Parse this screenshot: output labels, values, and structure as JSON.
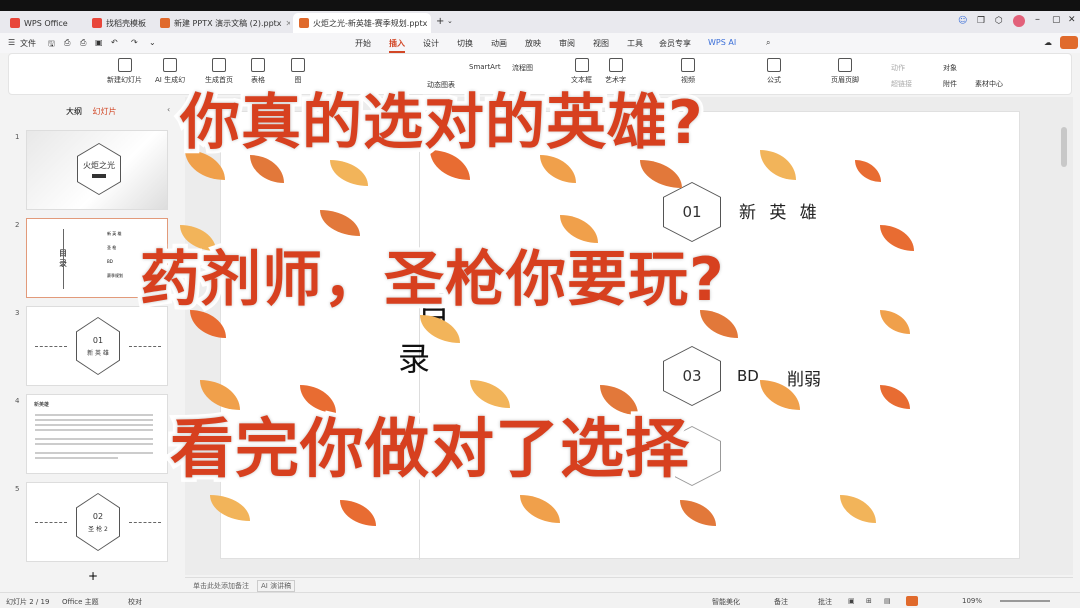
{
  "tabs": [
    {
      "label": "WPS Office",
      "color": "#e8463a"
    },
    {
      "label": "找稻壳模板",
      "color": "#e8463a"
    },
    {
      "label": "新建 PPTX 演示文稿 (2).pptx",
      "color": "#e06a2c"
    },
    {
      "label": "火炬之光-新英雄-赛季规划.pptx",
      "color": "#e06a2c"
    }
  ],
  "menu": {
    "file": "文件",
    "items": [
      "开始",
      "插入",
      "设计",
      "切换",
      "动画",
      "放映",
      "审阅",
      "视图",
      "工具",
      "会员专享",
      "WPS AI"
    ],
    "active": "插入"
  },
  "ribbon": {
    "new_slide": "新建幻灯片",
    "ai_generate": "AI 生成幻",
    "cover": "生成首页",
    "table": "表格",
    "chart": "图",
    "smartart": "SmartArt",
    "flowchart": "流程图",
    "dynamic_chart": "动态图表",
    "textbox": "文本框",
    "art": "艺术字",
    "video": "视频",
    "formula": "公式",
    "header_footer": "页眉页脚",
    "action": "动作",
    "hyperlink": "超链接",
    "object": "对象",
    "attach": "附件",
    "material": "素材中心",
    "outline_tab": "大纲",
    "slides_tab": "幻灯片"
  },
  "thumbnails": [
    {
      "num": "1",
      "title": "火炬之光"
    },
    {
      "num": "2",
      "title": "目录",
      "items": [
        "新 英 雄",
        "圣 枪",
        "BD",
        "赛季规划"
      ]
    },
    {
      "num": "3",
      "hex": "01",
      "label": "新 英 雄"
    },
    {
      "num": "4",
      "heading": "新英雄"
    },
    {
      "num": "5",
      "hex": "02",
      "label": "圣 枪 2"
    }
  ],
  "slide": {
    "mulu_1": "目",
    "mulu_2": "录",
    "item1_num": "01",
    "item1_label": "新 英 雄",
    "item3_num": "03",
    "item3_label1": "BD",
    "item3_label2": "削弱"
  },
  "overlay": {
    "line1": "你真的选对的英雄?",
    "line2": "药剂师，圣枪你要玩?",
    "line3": "看完你做对了选择"
  },
  "notes_placeholder": "单击此处添加备注",
  "notes_ai": "AI 演讲稿",
  "status": {
    "page": "幻灯片 2 / 19",
    "theme": "Office 主题",
    "proofread": "校对",
    "beautify": "智能美化",
    "remark": "备注",
    "comment": "批注",
    "zoom": "109%"
  },
  "colors": {
    "accent": "#d24726",
    "overlay": "#d7401f"
  }
}
